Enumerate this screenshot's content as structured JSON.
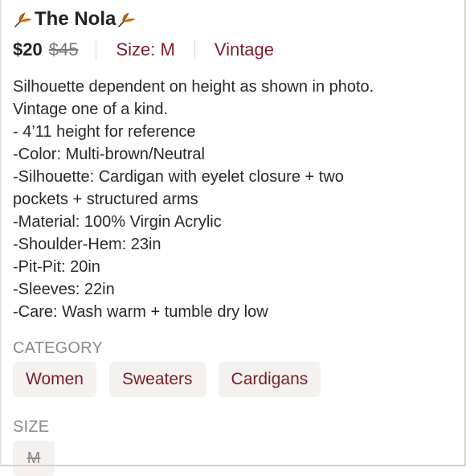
{
  "listing": {
    "title": "The Nola",
    "title_icons": [
      "maple-leaf-icon",
      "maple-leaf-icon"
    ],
    "price": "$20",
    "original_price": "$45",
    "size_text": "Size: M",
    "brand": "Vintage",
    "description": "Silhouette dependent on height as shown in photo.\nVintage one of a kind.\n- 4’11 height for reference\n-Color: Multi-brown/Neutral\n-Silhouette: Cardigan with eyelet closure + two\npockets + structured arms\n-Material: 100% Virgin Acrylic\n-Shoulder-Hem: 23in\n-Pit-Pit: 20in\n-Sleeves: 22in\n-Care: Wash warm + tumble dry low"
  },
  "category": {
    "label": "CATEGORY",
    "items": [
      "Women",
      "Sweaters",
      "Cardigans"
    ]
  },
  "size": {
    "label": "SIZE",
    "value": "M"
  },
  "colors": {
    "accent": "#7a1f2c",
    "chip_bg": "#f4f1ee",
    "muted": "#8a8a8a",
    "leaf": "#c0641a"
  }
}
